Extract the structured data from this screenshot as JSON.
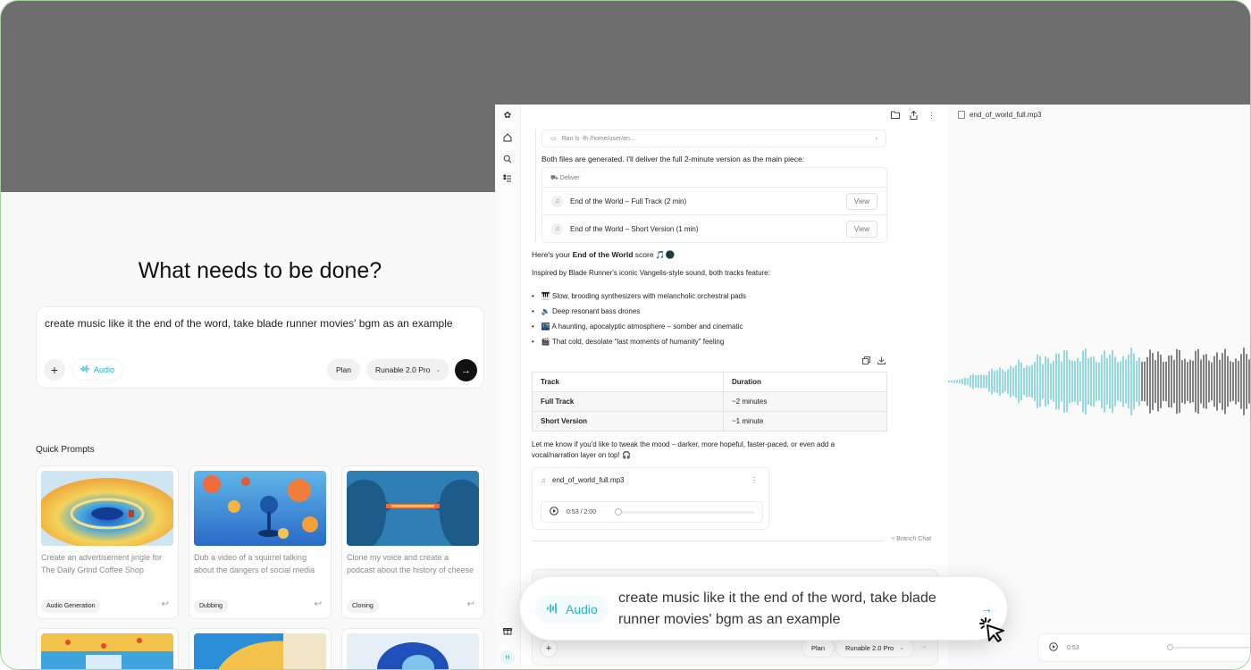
{
  "left": {
    "heading": "What needs to be done?",
    "compose_text": "create music like it the end of the word, take blade runner movies' bgm as an example",
    "add_label": "+",
    "audio_label": "Audio",
    "plan_label": "Plan",
    "model_label": "Runable 2.0 Pro",
    "send_label": "→",
    "quick_prompts_title": "Quick Prompts",
    "cards": [
      {
        "desc": "Create an advertisement jingle for The Daily Grind Coffee Shop",
        "tag": "Audio Generation"
      },
      {
        "desc": "Dub a video of a squirrel talking about the dangers of social media",
        "tag": "Dubbing"
      },
      {
        "desc": "Clone my voice and create a podcast about the history of cheese",
        "tag": "Cloning"
      }
    ]
  },
  "sidebar": {
    "icons": [
      "logo-icon",
      "home-icon",
      "search-icon",
      "tasks-icon"
    ],
    "avatar_initial": "H"
  },
  "chat": {
    "run_command": "Ran ls -lh /home/user/en...",
    "both_files": "Both files are generated. I'll deliver the full 2-minute version as the main piece:",
    "deliver_label": "Deliver",
    "deliver_items": [
      {
        "name": "End of the World – Full Track (2 min)",
        "button": "View"
      },
      {
        "name": "End of the World – Short Version (1 min)",
        "button": "View"
      }
    ],
    "score_prefix": "Here's your ",
    "score_bold": "End of the World",
    "score_suffix": " score 🎵🌑",
    "inspired": "Inspired by Blade Runner's iconic Vangelis-style sound, both tracks feature:",
    "bullets": [
      "🎹 Slow, brooding synthesizers with melancholic orchestral pads",
      "🔉 Deep resonant bass drones",
      "🌃 A haunting, apocalyptic atmosphere – somber and cinematic",
      "🎬 That cold, desolate \"last moments of humanity\" feeling"
    ],
    "table": {
      "headers": [
        "Track",
        "Duration"
      ],
      "rows": [
        [
          "Full Track",
          "~2 minutes"
        ],
        [
          "Short Version",
          "~1 minute"
        ]
      ]
    },
    "tweak_text": "Let me know if you'd like to tweak the mood – darker, more hopeful, faster-paced, or even add a vocal/narration layer on top! 🎧",
    "audio_file": "end_of_world_full.mp3",
    "player_time": "0:53 / 2:00",
    "branch_label": "Branch Chat",
    "bottom_plan": "Plan",
    "bottom_model": "Runable 2.0 Pro"
  },
  "right": {
    "file_name": "end_of_world_full.mp3",
    "mini_time": "0:53"
  },
  "bubble": {
    "audio_label": "Audio",
    "text": "create music like it the end of the word, take blade runner movies' bgm as an example"
  },
  "colors": {
    "accent": "#19b7d3",
    "wave_played": "#4cc3d5",
    "wave_unplayed": "#333333",
    "backdrop": "#6e6e6e"
  }
}
